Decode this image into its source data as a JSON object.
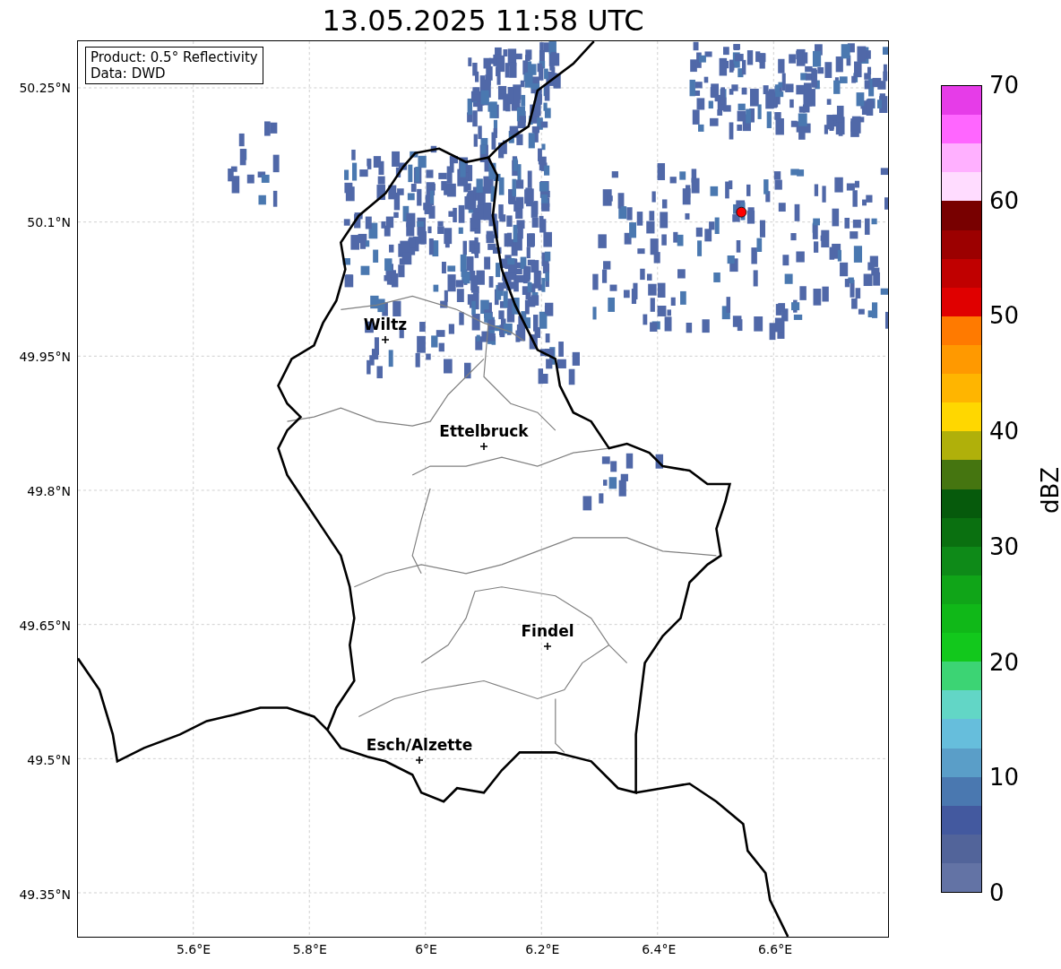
{
  "title": "13.05.2025 11:58 UTC",
  "info_box": [
    "Product: 0.5° Reflectivity",
    "Data: DWD"
  ],
  "lat_ticks": [
    "50.25°N",
    "50.1°N",
    "49.95°N",
    "49.8°N",
    "49.65°N",
    "49.5°N",
    "49.35°N"
  ],
  "lon_ticks": [
    "5.6°E",
    "5.8°E",
    "6°E",
    "6.2°E",
    "6.4°E",
    "6.6°E"
  ],
  "cities": [
    {
      "name": "Wiltz"
    },
    {
      "name": "Ettelbruck"
    },
    {
      "name": "Findel"
    },
    {
      "name": "Esch/Alzette"
    }
  ],
  "colorbar": {
    "label": "dBZ",
    "ticks": [
      "70",
      "60",
      "50",
      "40",
      "30",
      "20",
      "10",
      "0"
    ],
    "bins": [
      {
        "color": "#e63ce8"
      },
      {
        "color": "#ff66ff"
      },
      {
        "color": "#ffb0ff"
      },
      {
        "color": "#ffdcff"
      },
      {
        "color": "#780000"
      },
      {
        "color": "#9c0000"
      },
      {
        "color": "#c00000"
      },
      {
        "color": "#e00000"
      },
      {
        "color": "#ff7a00"
      },
      {
        "color": "#ff9900"
      },
      {
        "color": "#ffb500"
      },
      {
        "color": "#ffd700"
      },
      {
        "color": "#b0b00a"
      },
      {
        "color": "#457510"
      },
      {
        "color": "#065a0c"
      },
      {
        "color": "#0a7010"
      },
      {
        "color": "#0e8a18"
      },
      {
        "color": "#10a518"
      },
      {
        "color": "#10b818"
      },
      {
        "color": "#12c81c"
      },
      {
        "color": "#3cd474"
      },
      {
        "color": "#62d6c6"
      },
      {
        "color": "#66bedc"
      },
      {
        "color": "#5a9ec8"
      },
      {
        "color": "#4a78b0"
      },
      {
        "color": "#43599f"
      },
      {
        "color": "#52649a"
      },
      {
        "color": "#6373a5"
      }
    ]
  }
}
